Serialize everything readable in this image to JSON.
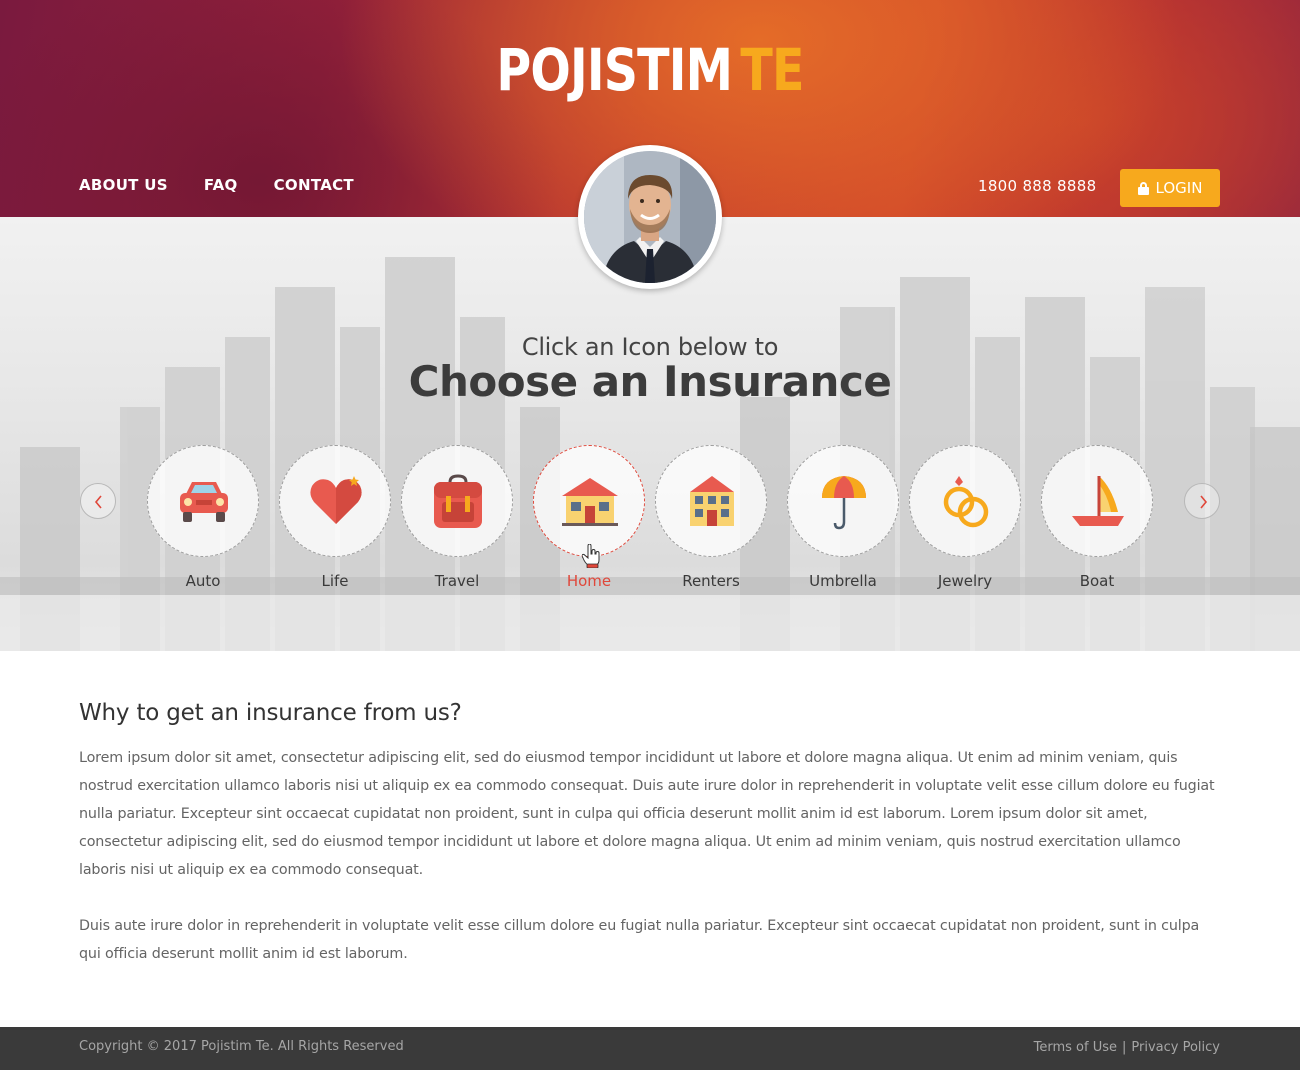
{
  "brand": {
    "name": "POJISTIM",
    "accent": "TE",
    "accent_color": "#f7a91d"
  },
  "nav": {
    "items": [
      {
        "label": "ABOUT US"
      },
      {
        "label": "FAQ"
      },
      {
        "label": "CONTACT"
      }
    ]
  },
  "header": {
    "phone": "1800 888 8888",
    "login_label": "LOGIN"
  },
  "hero": {
    "subtitle": "Click an Icon below to",
    "title": "Choose an Insurance",
    "items": [
      {
        "label": "Auto",
        "icon": "car-icon"
      },
      {
        "label": "Life",
        "icon": "heart-icon"
      },
      {
        "label": "Travel",
        "icon": "backpack-icon"
      },
      {
        "label": "Home",
        "icon": "house-icon",
        "active": true
      },
      {
        "label": "Renters",
        "icon": "building-icon"
      },
      {
        "label": "Umbrella",
        "icon": "umbrella-icon"
      },
      {
        "label": "Jewelry",
        "icon": "rings-icon"
      },
      {
        "label": "Boat",
        "icon": "boat-icon"
      }
    ],
    "active_color": "#e0473a"
  },
  "content": {
    "heading": "Why to get an insurance from us?",
    "paragraph1": "Lorem ipsum dolor sit amet, consectetur adipiscing elit, sed do eiusmod tempor incididunt ut labore et dolore magna aliqua. Ut enim ad minim veniam, quis nostrud exercitation ullamco laboris nisi ut aliquip ex ea commodo consequat. Duis aute irure dolor in reprehenderit in voluptate velit esse cillum dolore eu fugiat nulla pariatur. Excepteur sint occaecat cupidatat non proident, sunt in culpa qui officia deserunt mollit anim id est laborum. Lorem ipsum dolor sit amet, consectetur adipiscing elit, sed do eiusmod tempor incididunt ut labore et dolore magna aliqua. Ut enim ad minim veniam, quis nostrud exercitation ullamco laboris nisi ut aliquip ex ea commodo consequat.",
    "paragraph2": "Duis aute irure dolor in reprehenderit in voluptate velit esse cillum dolore eu fugiat nulla pariatur. Excepteur sint occaecat cupidatat non proident, sunt in culpa qui officia deserunt mollit anim id est laborum."
  },
  "footer": {
    "copyright": "Copyright © 2017 Pojistim Te. All Rights Reserved",
    "terms": "Terms of Use",
    "separator": "|",
    "privacy": "Privacy Policy"
  }
}
